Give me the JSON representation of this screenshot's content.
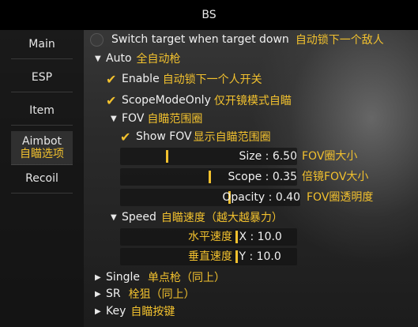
{
  "window": {
    "title": "BS"
  },
  "sidebar": {
    "items": [
      {
        "label": "Main",
        "annotation": ""
      },
      {
        "label": "ESP",
        "annotation": ""
      },
      {
        "label": "Item",
        "annotation": ""
      },
      {
        "label": "Aimbot",
        "annotation": "自瞄选项"
      },
      {
        "label": "Recoil",
        "annotation": ""
      }
    ],
    "active": "Aimbot"
  },
  "options": {
    "switch_target": {
      "label": "Switch target when target down",
      "annotation": "自动锁下一个敌人",
      "checked": false
    },
    "auto": {
      "label": "Auto",
      "annotation": "全自动枪",
      "expanded": true
    },
    "enable": {
      "label": "Enable",
      "annotation": "自动锁下一个人开关",
      "checked": true
    },
    "scope_mode_only": {
      "label": "ScopeModeOnly",
      "annotation": "仅开镜模式自瞄",
      "checked": true
    },
    "fov": {
      "label": "FOV",
      "annotation": "自瞄范围圈",
      "expanded": true
    },
    "show_fov": {
      "label": "Show FOV",
      "annotation": "显示自瞄范围圈",
      "checked": true
    },
    "size": {
      "text": "Size : 6.50",
      "annotation": "FOV圈大小",
      "fraction": 0.26
    },
    "scope": {
      "text": "Scope : 0.35",
      "annotation": "倍镜FOV大小",
      "fraction": 0.5
    },
    "opacity": {
      "text": "Opacity : 0.40",
      "annotation": "FOV圈透明度",
      "fraction": 0.6
    },
    "speed": {
      "label": "Speed",
      "annotation": "自瞄速度（越大越暴力）",
      "expanded": true
    },
    "horizontal": {
      "annotation": "水平速度",
      "text": "X : 10.0",
      "fraction": 0.65
    },
    "vertical": {
      "annotation": "垂直速度",
      "text": "Y : 10.0",
      "fraction": 0.65
    },
    "single": {
      "label": "Single",
      "annotation": "单点枪（同上）",
      "expanded": false
    },
    "sr": {
      "label": "SR",
      "annotation": "栓狙（同上）",
      "expanded": false
    },
    "key": {
      "label": "Key",
      "annotation": "自瞄按键",
      "expanded": false
    }
  },
  "glyphs": {
    "expanded": "▼",
    "collapsed": "▶",
    "check": "✔"
  },
  "colors": {
    "accent": "#f2c12e",
    "titlebar": "#000000"
  }
}
